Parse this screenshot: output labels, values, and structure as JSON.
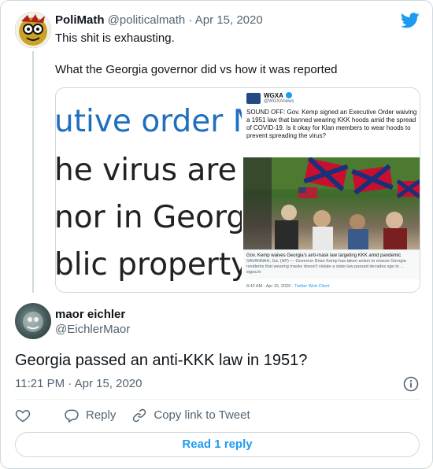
{
  "parent_tweet": {
    "name": "PoliMath",
    "handle": "@politicalmath",
    "separator": "·",
    "date": "Apr 15, 2020",
    "text_line1": "This shit is exhausting.",
    "text_line2": "What the Georgia governor did vs how it was reported"
  },
  "media": {
    "crop_lines": [
      "utive order Mo",
      "he virus are ex",
      "nor in Georgia",
      "blic property."
    ],
    "screenshot": {
      "account_name": "WGXA",
      "account_handle": "@WGXAnews",
      "tweet_text": "SOUND OFF: Gov. Kemp signed an Executive Order waiving a 1951 law that banned wearing KKK hoods amid the spread of COVID-19. Is it okay for Klan members to wear hoods to prevent spreading the virus?",
      "card_title": "Gov. Kemp waives Georgia's anti-mask law targeting KKK amid pandemic",
      "card_desc": "SAVANNAH, Ga. (AP) — Governor Brian Kemp has taken action to ensure Georgia residents that wearing masks doesn't violate a state law passed decades ago to ...",
      "card_domain": "wgxa.tv",
      "footer_time": "8:42 AM · Apr 15, 2020 ·",
      "footer_source": "Twitter Web Client"
    }
  },
  "main_tweet": {
    "name": "maor eichler",
    "handle": "@EichlerMaor",
    "text": "Georgia passed an anti-KKK law in 1951?",
    "timestamp": "11:21 PM · Apr 15, 2020"
  },
  "actions": {
    "reply_label": "Reply",
    "copy_link_label": "Copy link to Tweet"
  },
  "read_replies_label": "Read 1 reply",
  "icons": [
    "twitter-logo-icon",
    "info-icon",
    "heart-icon",
    "reply-icon",
    "link-icon"
  ],
  "colors": {
    "brand_blue": "#1d9bf0",
    "text_primary": "#0f1419",
    "text_secondary": "#536471",
    "border": "#cfd9de"
  }
}
